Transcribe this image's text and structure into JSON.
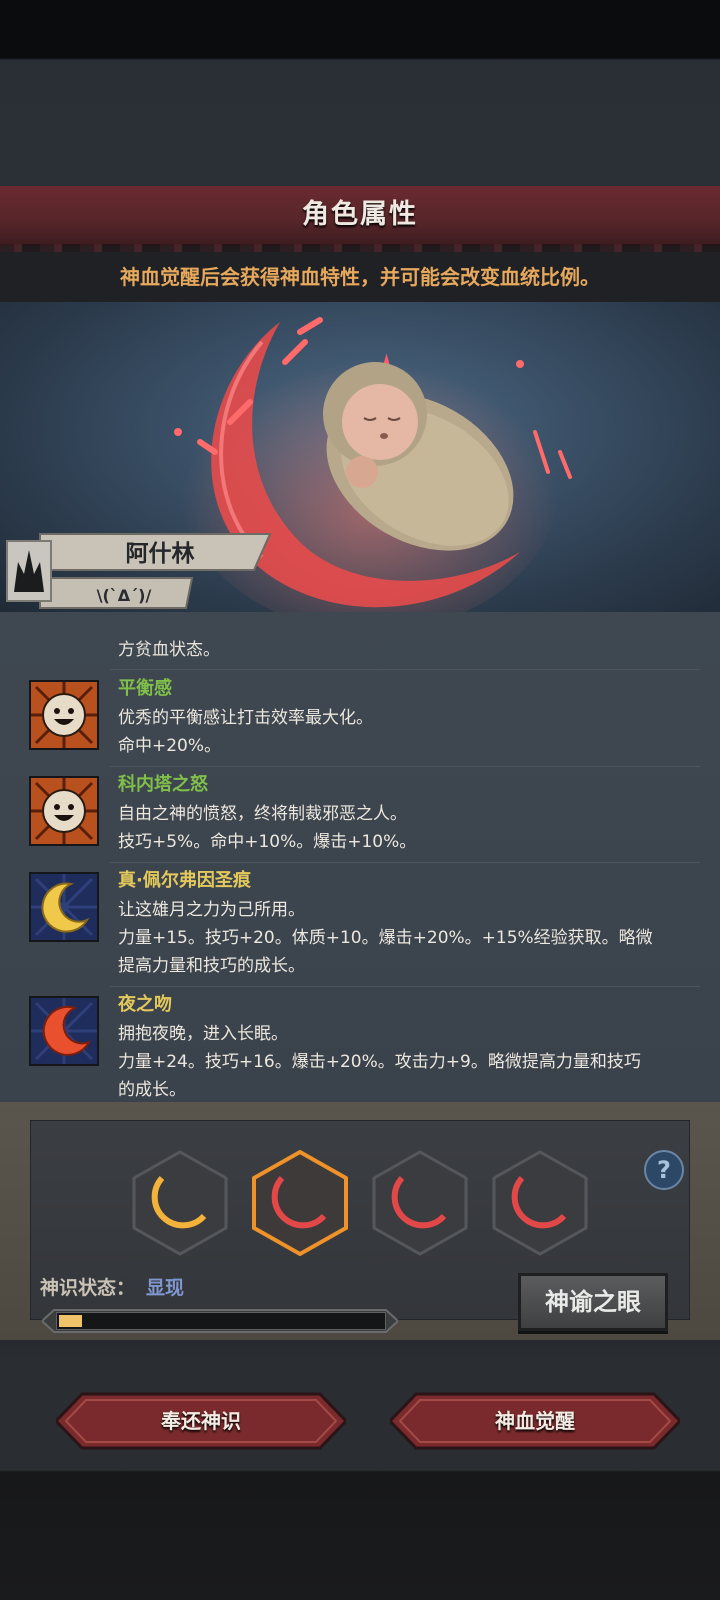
{
  "header": {
    "title": "角色属性",
    "subtitle": "神血觉醒后会获得神血特性，并可能会改变血统比例。"
  },
  "character": {
    "name": "阿什林",
    "emote": "\\(`Δ´)/"
  },
  "traits": {
    "partial_desc_line": "方贫血状态。",
    "items": [
      {
        "name": "平衡感",
        "name_color": "#7fbf4a",
        "icon": "sun-face-icon",
        "desc1": "优秀的平衡感让打击效率最大化。",
        "desc2": "命中+20%。"
      },
      {
        "name": "科内塔之怒",
        "name_color": "#7fbf4a",
        "icon": "sun-face-icon",
        "desc1": "自由之神的愤怒，终将制裁邪恶之人。",
        "desc2": "技巧+5%。命中+10%。爆击+10%。"
      },
      {
        "name": "真·佩尔弗因圣痕",
        "name_color": "#e3c85c",
        "icon": "crescent-moon-icon",
        "desc1": "让这雄月之力为己所用。",
        "desc2": "力量+15。技巧+20。体质+10。爆击+20%。+15%经验获取。略微",
        "desc3": "提高力量和技巧的成长。"
      },
      {
        "name": "夜之吻",
        "name_color": "#e3c85c",
        "icon": "red-crescent-icon",
        "desc1": "拥抱夜晚，进入长眠。",
        "desc2": "力量+24。技巧+16。爆击+20%。攻击力+9。略微提高力量和技巧",
        "desc3": "的成长。"
      }
    ]
  },
  "awakening": {
    "slots": [
      {
        "icon": "gold-crescent-slot-icon",
        "color": "#f3b23a",
        "selected": false
      },
      {
        "icon": "red-crescent-slot-icon",
        "color": "#e24848",
        "selected": true
      },
      {
        "icon": "red-crescent-slot-icon",
        "color": "#e24848",
        "selected": false
      },
      {
        "icon": "red-crescent-slot-icon",
        "color": "#e24848",
        "selected": false
      }
    ],
    "help": "?",
    "status_label": "神识状态：",
    "status_value": "显现",
    "progress": 0.07,
    "oracle_button": "神谕之眼"
  },
  "buttons": {
    "return": "奉还神识",
    "awaken": "神血觉醒"
  }
}
